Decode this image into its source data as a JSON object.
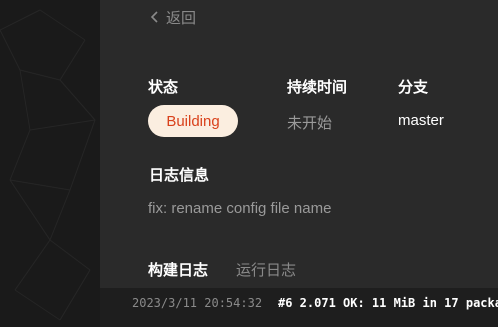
{
  "header": {
    "back_label": "返回"
  },
  "summary": {
    "status_label": "状态",
    "status_value": "Building",
    "duration_label": "持续时间",
    "duration_value": "未开始",
    "branch_label": "分支",
    "branch_value": "master"
  },
  "log_info": {
    "title": "日志信息",
    "message": "fix: rename config file name"
  },
  "tabs": [
    {
      "label": "构建日志",
      "active": true
    },
    {
      "label": "运行日志",
      "active": false
    }
  ],
  "log_line": {
    "timestamp": "2023/3/11 20:54:32",
    "text": "#6 2.071 OK: 11 MiB in 17 packa"
  },
  "colors": {
    "panel_bg": "#2a2a2a",
    "left_bg": "#1a1a1a",
    "status_badge_bg": "#fbeee0",
    "status_badge_text": "#d9411b",
    "muted_text": "#9a9a9a",
    "primary_text": "#ffffff"
  }
}
